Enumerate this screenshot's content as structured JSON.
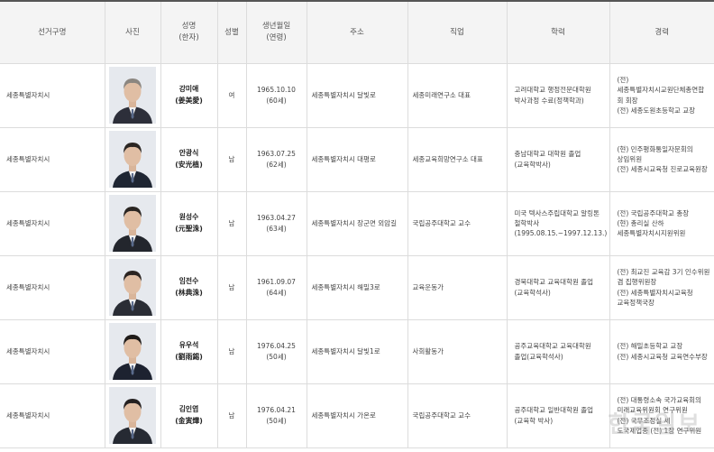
{
  "headers": {
    "district": "선거구명",
    "photo": "사진",
    "name_line1": "성명",
    "name_line2": "(한자)",
    "gender": "성별",
    "birth_line1": "생년월일",
    "birth_line2": "(연령)",
    "address": "주소",
    "job": "직업",
    "education": "학력",
    "career": "경력"
  },
  "candidates": [
    {
      "district": "세종특별자치시",
      "name": "강미애",
      "hanja": "(姜美愛)",
      "gender": "여",
      "birth": "1965.10.10",
      "age": "(60세)",
      "address": "세종특별자치시 달빛로",
      "job": "세종미래연구소 대표",
      "edu1": "고려대학교 행정전문대학원",
      "edu2": "박사과정 수료(정책학과)",
      "car1": "(전)",
      "car2": "세종특별자치시교원단체총연합",
      "car3": "회 회장",
      "car4": "(전) 세종도원초등학교 교장"
    },
    {
      "district": "세종특별자치시",
      "name": "안광식",
      "hanja": "(安光植)",
      "gender": "남",
      "birth": "1963.07.25",
      "age": "(62세)",
      "address": "세종특별자치시 대평로",
      "job": "세종교육희망연구소 대표",
      "edu1": "충남대학교 대학원 졸업",
      "edu2": "(교육학박사)",
      "car1": "(현) 민주평화통일자문회의",
      "car2": "상임위원",
      "car3": "(전) 세종시교육청 진로교육원장",
      "car4": ""
    },
    {
      "district": "세종특별자치시",
      "name": "원성수",
      "hanja": "(元聖洙)",
      "gender": "남",
      "birth": "1963.04.27",
      "age": "(63세)",
      "address": "세종특별자치시 장군면 외암길",
      "job": "국립공주대학교 교수",
      "edu1": "미국 텍사스주립대학교 알링톤",
      "edu2": "철학박사",
      "edu3": "(1995.08.15.~1997.12.13.)",
      "car1": "(전) 국립공주대학교 총장",
      "car2": "(현) 총리실 산하",
      "car3": "세종특별자치시지원위원",
      "car4": ""
    },
    {
      "district": "세종특별자치시",
      "name": "임전수",
      "hanja": "(林典洙)",
      "gender": "남",
      "birth": "1961.09.07",
      "age": "(64세)",
      "address": "세종특별자치시 해밀3로",
      "job": "교육운동가",
      "edu1": "경북대학교 교육대학원 졸업",
      "edu2": "(교육학석사)",
      "car1": "(전) 최교진 교육감 3기 인수위원",
      "car2": "겸 집행위원장",
      "car3": "(전) 세종특별자치시교육청",
      "car4": "교육정책국장"
    },
    {
      "district": "세종특별자치시",
      "name": "유우석",
      "hanja": "(劉雨錫)",
      "gender": "남",
      "birth": "1976.04.25",
      "age": "(50세)",
      "address": "세종특별자치시 달빛1로",
      "job": "사회활동가",
      "edu1": "공주교육대학교 교육대학원",
      "edu2": "졸업(교육학석사)",
      "car1": "(전) 해밀초등학교 교장",
      "car2": "(전) 세종시교육청 교육연수부장",
      "car3": "",
      "car4": ""
    },
    {
      "district": "세종특별자치시",
      "name": "김인엽",
      "hanja": "(金寅燁)",
      "gender": "남",
      "birth": "1976.04.21",
      "age": "(50세)",
      "address": "세종특별자치시 가온로",
      "job": "국립공주대학교 교수",
      "edu1": "공주대학교 일반대학원 졸업",
      "edu2": "(교육학 박사)",
      "car1": "(전) 대통령소속 국가교육회의",
      "car2": "미래교육위원회 연구위원",
      "car3": "(전) 국무조정실 세",
      "car4": "도국제업종 (전) 1장 연구위원"
    }
  ],
  "watermark": "한국일보",
  "colors": {
    "header_bg": "#f4f4f4",
    "border": "#dcdcdc",
    "header_top_border": "#555555"
  }
}
